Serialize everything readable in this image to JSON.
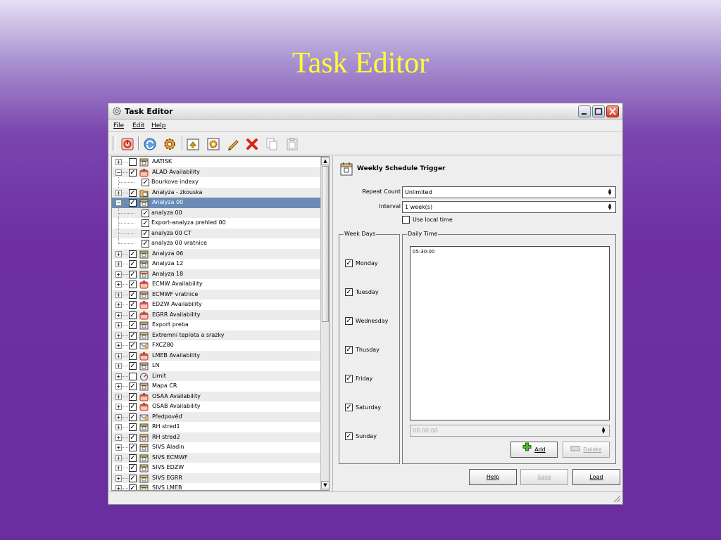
{
  "slide": {
    "title": "Task Editor"
  },
  "window": {
    "title": "Task Editor",
    "menu": [
      "File",
      "Edit",
      "Help"
    ],
    "toolbar_icons": [
      "exit-icon",
      "refresh-icon",
      "run-task-icon",
      "import-icon",
      "configure-icon",
      "edit-pencil-icon",
      "delete-icon",
      "copy-icon",
      "paste-icon"
    ]
  },
  "tree": {
    "rows": [
      {
        "label": "AATISK",
        "level": 0,
        "expander": "+",
        "checked": false,
        "icon": "task-icon",
        "alt": false,
        "selected": false
      },
      {
        "label": "ALAD Availability",
        "level": 0,
        "expander": "-",
        "checked": true,
        "icon": "availability-icon",
        "alt": true,
        "selected": false
      },
      {
        "label": "Bourkove indexy",
        "level": 1,
        "checked": true,
        "alt": false,
        "selected": false
      },
      {
        "label": "Analyza - zkouska",
        "level": 0,
        "expander": "+",
        "checked": true,
        "icon": "folder-task-icon",
        "alt": true,
        "selected": false
      },
      {
        "label": "Analyza 00",
        "level": 0,
        "expander": "-",
        "checked": true,
        "icon": "task-icon",
        "alt": false,
        "selected": true
      },
      {
        "label": "analyza 00",
        "level": 1,
        "checked": true,
        "alt": true,
        "selected": false
      },
      {
        "label": "Export-analyza prehled 00",
        "level": 1,
        "checked": true,
        "alt": false,
        "selected": false
      },
      {
        "label": "analyza 00 CT",
        "level": 1,
        "checked": true,
        "alt": true,
        "selected": false
      },
      {
        "label": "analyza 00 vratnice",
        "level": 1,
        "checked": true,
        "alt": false,
        "selected": false,
        "last": true
      },
      {
        "label": "Analyza 06",
        "level": 0,
        "expander": "+",
        "checked": true,
        "icon": "task-icon",
        "alt": true,
        "selected": false
      },
      {
        "label": "Analyza 12",
        "level": 0,
        "expander": "+",
        "checked": true,
        "icon": "task-icon",
        "alt": false,
        "selected": false
      },
      {
        "label": "Analyza 18",
        "level": 0,
        "expander": "+",
        "checked": true,
        "icon": "task-icon",
        "alt": true,
        "selected": false
      },
      {
        "label": "ECMW Availability",
        "level": 0,
        "expander": "+",
        "checked": true,
        "icon": "availability-icon",
        "alt": false,
        "selected": false
      },
      {
        "label": "ECMWF vratnice",
        "level": 0,
        "expander": "+",
        "checked": true,
        "icon": "task-icon",
        "alt": true,
        "selected": false
      },
      {
        "label": "EDZW Availability",
        "level": 0,
        "expander": "+",
        "checked": true,
        "icon": "availability-icon",
        "alt": false,
        "selected": false
      },
      {
        "label": "EGRR Availability",
        "level": 0,
        "expander": "+",
        "checked": true,
        "icon": "availability-icon",
        "alt": true,
        "selected": false
      },
      {
        "label": "Export preba",
        "level": 0,
        "expander": "+",
        "checked": true,
        "icon": "task-icon",
        "alt": false,
        "selected": false
      },
      {
        "label": "Extremni teplota a srazky",
        "level": 0,
        "expander": "+",
        "checked": true,
        "icon": "task-icon",
        "alt": true,
        "selected": false
      },
      {
        "label": "FXCZ80",
        "level": 0,
        "expander": "+",
        "checked": true,
        "icon": "mail-icon",
        "alt": false,
        "selected": false
      },
      {
        "label": "LMEB Availability",
        "level": 0,
        "expander": "+",
        "checked": true,
        "icon": "availability-icon",
        "alt": true,
        "selected": false
      },
      {
        "label": "LN",
        "level": 0,
        "expander": "+",
        "checked": true,
        "icon": "task-icon",
        "alt": false,
        "selected": false
      },
      {
        "label": "Limit",
        "level": 0,
        "expander": "+",
        "checked": false,
        "icon": "gauge-icon",
        "alt": true,
        "selected": false
      },
      {
        "label": "Mapa CR",
        "level": 0,
        "expander": "+",
        "checked": true,
        "icon": "task-icon",
        "alt": false,
        "selected": false
      },
      {
        "label": "OSAA Availability",
        "level": 0,
        "expander": "+",
        "checked": true,
        "icon": "availability-icon",
        "alt": true,
        "selected": false
      },
      {
        "label": "OSAB Availability",
        "level": 0,
        "expander": "+",
        "checked": true,
        "icon": "availability-icon",
        "alt": false,
        "selected": false
      },
      {
        "label": "Předpověď",
        "level": 0,
        "expander": "+",
        "checked": true,
        "icon": "mail-icon",
        "alt": true,
        "selected": false
      },
      {
        "label": "RH stred1",
        "level": 0,
        "expander": "+",
        "checked": true,
        "icon": "task-icon",
        "alt": false,
        "selected": false
      },
      {
        "label": "RH stred2",
        "level": 0,
        "expander": "+",
        "checked": true,
        "icon": "task-icon",
        "alt": true,
        "selected": false
      },
      {
        "label": "SIVS Aladin",
        "level": 0,
        "expander": "+",
        "checked": true,
        "icon": "task-icon",
        "alt": false,
        "selected": false
      },
      {
        "label": "SIVS ECMWF",
        "level": 0,
        "expander": "+",
        "checked": true,
        "icon": "task-icon",
        "alt": true,
        "selected": false
      },
      {
        "label": "SIVS EDZW",
        "level": 0,
        "expander": "+",
        "checked": true,
        "icon": "task-icon",
        "alt": false,
        "selected": false
      },
      {
        "label": "SIVS EGRR",
        "level": 0,
        "expander": "+",
        "checked": true,
        "icon": "task-icon",
        "alt": true,
        "selected": false
      },
      {
        "label": "SIVS LMEB",
        "level": 0,
        "expander": "+",
        "checked": true,
        "icon": "task-icon",
        "alt": false,
        "selected": false
      }
    ]
  },
  "trigger": {
    "title": "Weekly Schedule Trigger",
    "repeat_count_label": "Repeat Count",
    "repeat_count_value": "Unlimited",
    "interval_label": "Interval",
    "interval_value": "1 week(s)",
    "use_local_time_label": "Use local time",
    "use_local_time_checked": false,
    "week_days_legend": "Week Days",
    "days": [
      {
        "label": "Monday",
        "checked": true
      },
      {
        "label": "Tuesday",
        "checked": true
      },
      {
        "label": "Wednesday",
        "checked": true
      },
      {
        "label": "Thusday",
        "checked": true
      },
      {
        "label": "Friday",
        "checked": true
      },
      {
        "label": "Saturday",
        "checked": true
      },
      {
        "label": "Sunday",
        "checked": true
      }
    ],
    "daily_time_legend": "Daily Time",
    "times": [
      "05:30:00"
    ],
    "time_input_value": "00:00:00",
    "add_label": "Add",
    "delete_label": "Delete"
  },
  "bottom_buttons": {
    "help": "Help",
    "save": "Save",
    "load": "Load"
  },
  "colors": {
    "slide_title": "#ffff33",
    "selection": "#6a8bb5",
    "close_button": "#d23b27"
  }
}
